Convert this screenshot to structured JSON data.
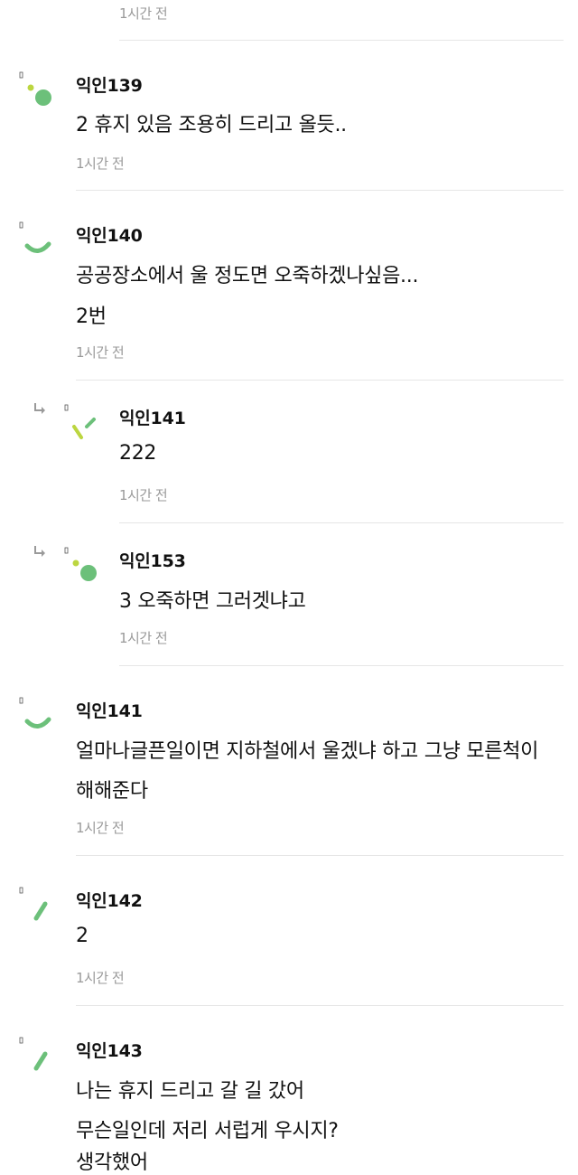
{
  "comments": [
    {
      "author": "",
      "lines": [],
      "time": "1시간 전"
    },
    {
      "author": "익인139",
      "lines": [
        "2 휴지 있음 조용히 드리고 올듯.."
      ],
      "time": "1시간 전",
      "avatar_icon": "dot-pair-avatar"
    },
    {
      "author": "익인140",
      "lines": [
        "공공장소에서 울 정도면 오죽하겠나싶음...",
        "2번"
      ],
      "time": "1시간 전",
      "avatar_icon": "arc-avatar"
    },
    {
      "author": "익인141",
      "lines": [
        "222"
      ],
      "time": "1시간 전",
      "avatar_icon": "check-avatar",
      "reply": true
    },
    {
      "author": "익인153",
      "lines": [
        "3 오죽하면 그러겟냐고"
      ],
      "time": "1시간 전",
      "avatar_icon": "dot-pair-avatar",
      "reply": true
    },
    {
      "author": "익인141",
      "lines": [
        "얼마나글픈일이면 지하철에서 울겠냐 하고 그냥 모른척이",
        "해해준다"
      ],
      "time": "1시간 전",
      "avatar_icon": "arc-avatar"
    },
    {
      "author": "익인142",
      "lines": [
        "2"
      ],
      "time": "1시간 전",
      "avatar_icon": "slash-avatar"
    },
    {
      "author": "익인143",
      "lines": [
        "나는 휴지 드리고 갈 길 갔어",
        "무슨일인데 저리 서럽게 우시지?",
        "생각했어"
      ],
      "time": "",
      "avatar_icon": "slash-avatar"
    }
  ],
  "colors": {
    "green": "#6cc07a",
    "lime": "#bcd640",
    "muted": "#9a9a9a",
    "divider": "#e6e6e6"
  }
}
